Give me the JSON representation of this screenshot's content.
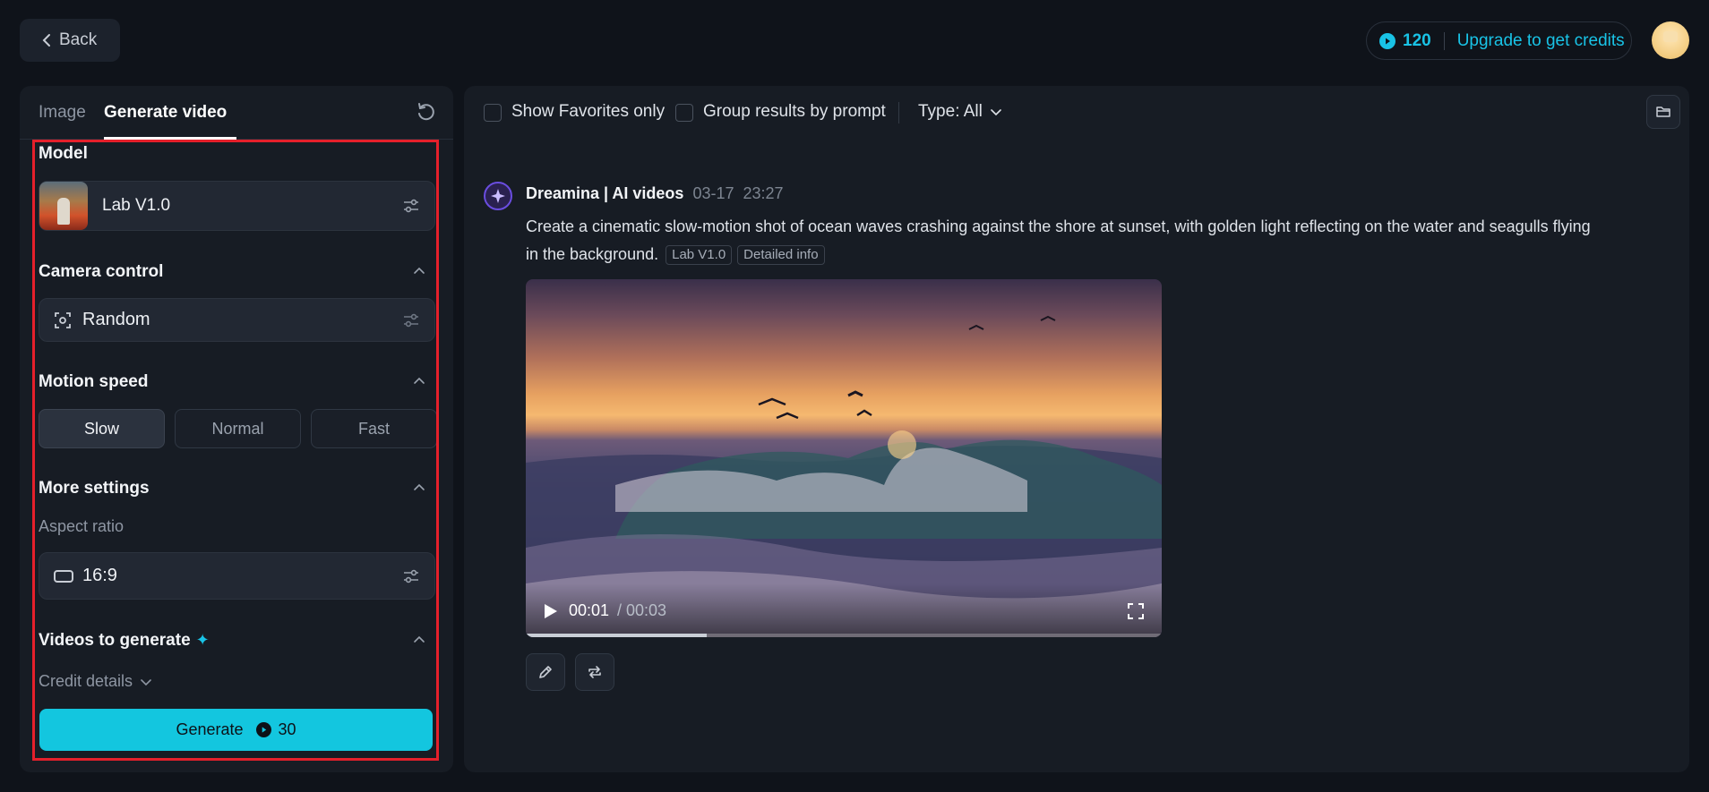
{
  "header": {
    "back_label": "Back",
    "credits": "120",
    "upgrade_label": "Upgrade to get credits"
  },
  "left_panel": {
    "tabs": [
      {
        "label": "Image",
        "active": false
      },
      {
        "label": "Generate video",
        "active": true
      }
    ],
    "model": {
      "section_title": "Model",
      "name": "Lab V1.0"
    },
    "camera_control": {
      "section_title": "Camera control",
      "value": "Random"
    },
    "motion_speed": {
      "section_title": "Motion speed",
      "options": [
        "Slow",
        "Normal",
        "Fast"
      ],
      "selected": "Slow"
    },
    "more_settings": {
      "section_title": "More settings",
      "aspect_ratio_label": "Aspect ratio",
      "aspect_ratio_value": "16:9"
    },
    "videos_to_generate": {
      "section_title": "Videos to generate",
      "credit_details_label": "Credit details"
    },
    "generate": {
      "label": "Generate",
      "cost": "30"
    }
  },
  "right_panel": {
    "filters": {
      "favorites_label": "Show Favorites only",
      "group_label": "Group results by prompt",
      "type_label": "Type: All"
    },
    "result": {
      "source": "Dreamina | AI videos",
      "date": "03-17",
      "time": "23:27",
      "prompt": "Create a cinematic slow-motion shot of ocean waves crashing against the shore at sunset, with golden light reflecting on the water and seagulls flying in the background.",
      "tags": [
        "Lab V1.0",
        "Detailed info"
      ],
      "video": {
        "current_time": "00:01",
        "duration": "/ 00:03",
        "progress": 0.285
      }
    }
  },
  "colors": {
    "accent": "#13c6df",
    "highlight": "#e5202b",
    "background": "#0f131a",
    "panel": "#171c24"
  }
}
